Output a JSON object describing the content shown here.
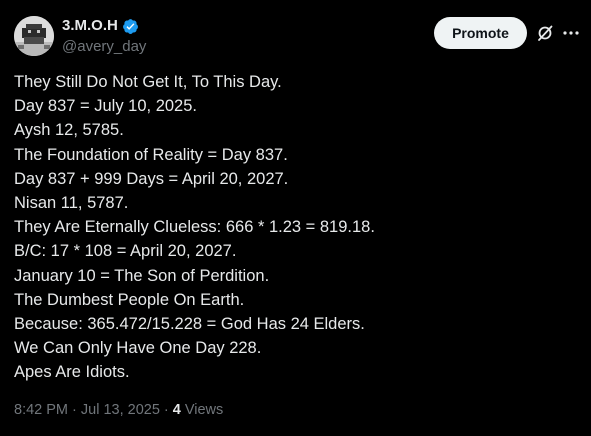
{
  "author": {
    "display_name": "3.M.O.H",
    "handle": "@avery_day"
  },
  "actions": {
    "promote_label": "Promote"
  },
  "post": {
    "lines": [
      "They Still Do Not Get It, To This Day.",
      "Day 837 = July 10, 2025.",
      "Aysh 12, 5785.",
      "The Foundation of Reality = Day 837.",
      "Day 837 + 999 Days = April 20, 2027.",
      "Nisan 11, 5787.",
      "They Are Eternally Clueless: 666 * 1.23 = 819.18.",
      "B/C: 17 * 108 = April 20, 2027.",
      "January 10 = The Son of Perdition.",
      "The Dumbest People On Earth.",
      "Because: 365.472/15.228 = God Has 24 Elders.",
      "We Can Only Have One Day 228.",
      "Apes Are Idiots."
    ]
  },
  "meta": {
    "time_date": "8:42 PM · Jul 13, 2025 ·",
    "views_count": "4",
    "views_label": "Views"
  },
  "icons": {
    "verified": "verified-badge-icon",
    "grok": "grok-icon",
    "more": "more-icon"
  },
  "colors": {
    "background": "#000000",
    "text": "#e7e9ea",
    "secondary": "#71767b",
    "verified": "#1d9bf0",
    "promote_bg": "#eff3f4"
  }
}
